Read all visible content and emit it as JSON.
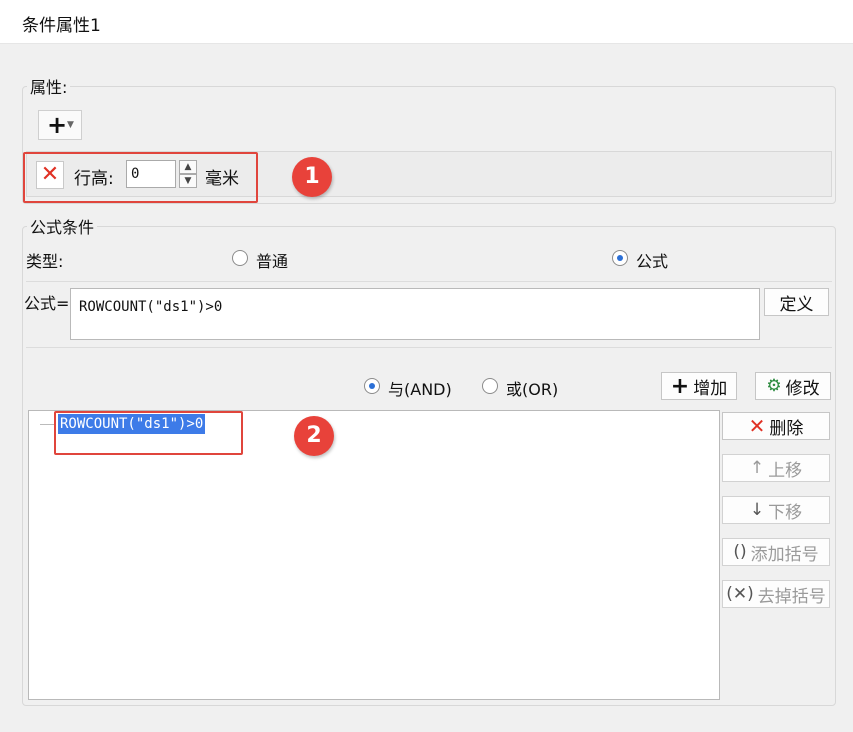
{
  "window": {
    "title": "条件属性1"
  },
  "attributes": {
    "legend": "属性:",
    "add_icon": "plus-icon",
    "row_height": {
      "label": "行高:",
      "value": "0",
      "unit": "毫米"
    }
  },
  "formula_condition": {
    "legend": "公式条件",
    "type_label": "类型:",
    "type_options": [
      "普通",
      "公式"
    ],
    "type_selected": "公式",
    "formula_label": "公式=",
    "formula_value": "ROWCOUNT(\"ds1\")>0",
    "define_button": "定义",
    "logic_options": [
      "与(AND)",
      "或(OR)"
    ],
    "logic_selected": "与(AND)",
    "add_button": "增加",
    "modify_button": "修改",
    "conditions": [
      "ROWCOUNT(\"ds1\")>0"
    ],
    "delete_button": "删除",
    "move_up_button": "上移",
    "move_down_button": "下移",
    "add_bracket_button": "添加括号",
    "remove_bracket_button": "去掉括号"
  },
  "callouts": [
    "1",
    "2"
  ],
  "colors": {
    "accent": "#e8423a",
    "selection": "#3d7be8",
    "radio_dot": "#2b6fd6"
  }
}
